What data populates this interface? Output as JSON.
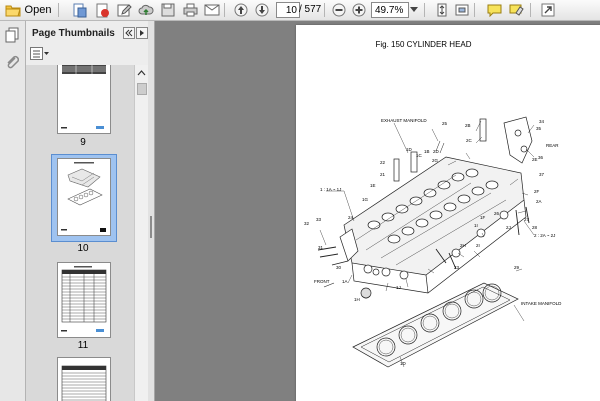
{
  "toolbar": {
    "open_label": "Open",
    "page_current": "10",
    "page_total": "/ 577",
    "zoom": "49.7%"
  },
  "panel": {
    "title": "Page Thumbnails",
    "thumbnails": [
      {
        "label": "9"
      },
      {
        "label": "10",
        "selected": true
      },
      {
        "label": "11"
      }
    ],
    "thumb10_title": "Fig. 150 Cylinder Head"
  },
  "document": {
    "figure_title": "Fig. 150 CYLINDER HEAD",
    "labels": {
      "exhaust": "EXHAUST MANIFOLD",
      "intake": "INTAKE MANIFOLD",
      "front": "FRONT",
      "rear": "REAR",
      "callout_left": "1 : 1A ~ 1J",
      "callout_right": "2 : 2A ~ 2J",
      "n25": "25",
      "n2B": "2B",
      "n2C": "2C",
      "n2D": "2D",
      "n2G": "2G",
      "n34": "34",
      "n35": "35",
      "n36": "36",
      "n37": "37",
      "n2E": "2E",
      "n2F": "2F",
      "n2A": "2A",
      "n22": "22",
      "n21": "21",
      "n1D": "1D",
      "n1C": "1C",
      "n1B": "1B",
      "n1E": "1E",
      "n1G": "1G",
      "n24": "24",
      "n27": "27",
      "n28": "28",
      "n26": "26",
      "n2J": "2J",
      "n1F": "1F",
      "n1I": "1I",
      "n32": "32",
      "n33": "33",
      "n31": "31",
      "n30": "30",
      "n1A": "1A",
      "n1H": "1H",
      "n2H": "2H",
      "n2I": "2I",
      "n29": "29",
      "n23": "23",
      "n1J": "1J",
      "n1d2": "1D"
    }
  },
  "colors": {
    "toolbar_bg": "#eeeeee",
    "doc_bg": "#808080",
    "selected_thumb": "#9fc3f0"
  },
  "icons": [
    "folder-open-icon",
    "print-icon",
    "pdf-create-icon",
    "edit-icon",
    "cloud-upload-icon",
    "save-icon",
    "print2-icon",
    "email-icon",
    "arrow-up-icon",
    "arrow-down-icon",
    "zoom-out-icon",
    "zoom-in-icon",
    "fit-page-icon",
    "fit-width-icon",
    "comment-icon",
    "sign-icon",
    "expand-icon"
  ]
}
